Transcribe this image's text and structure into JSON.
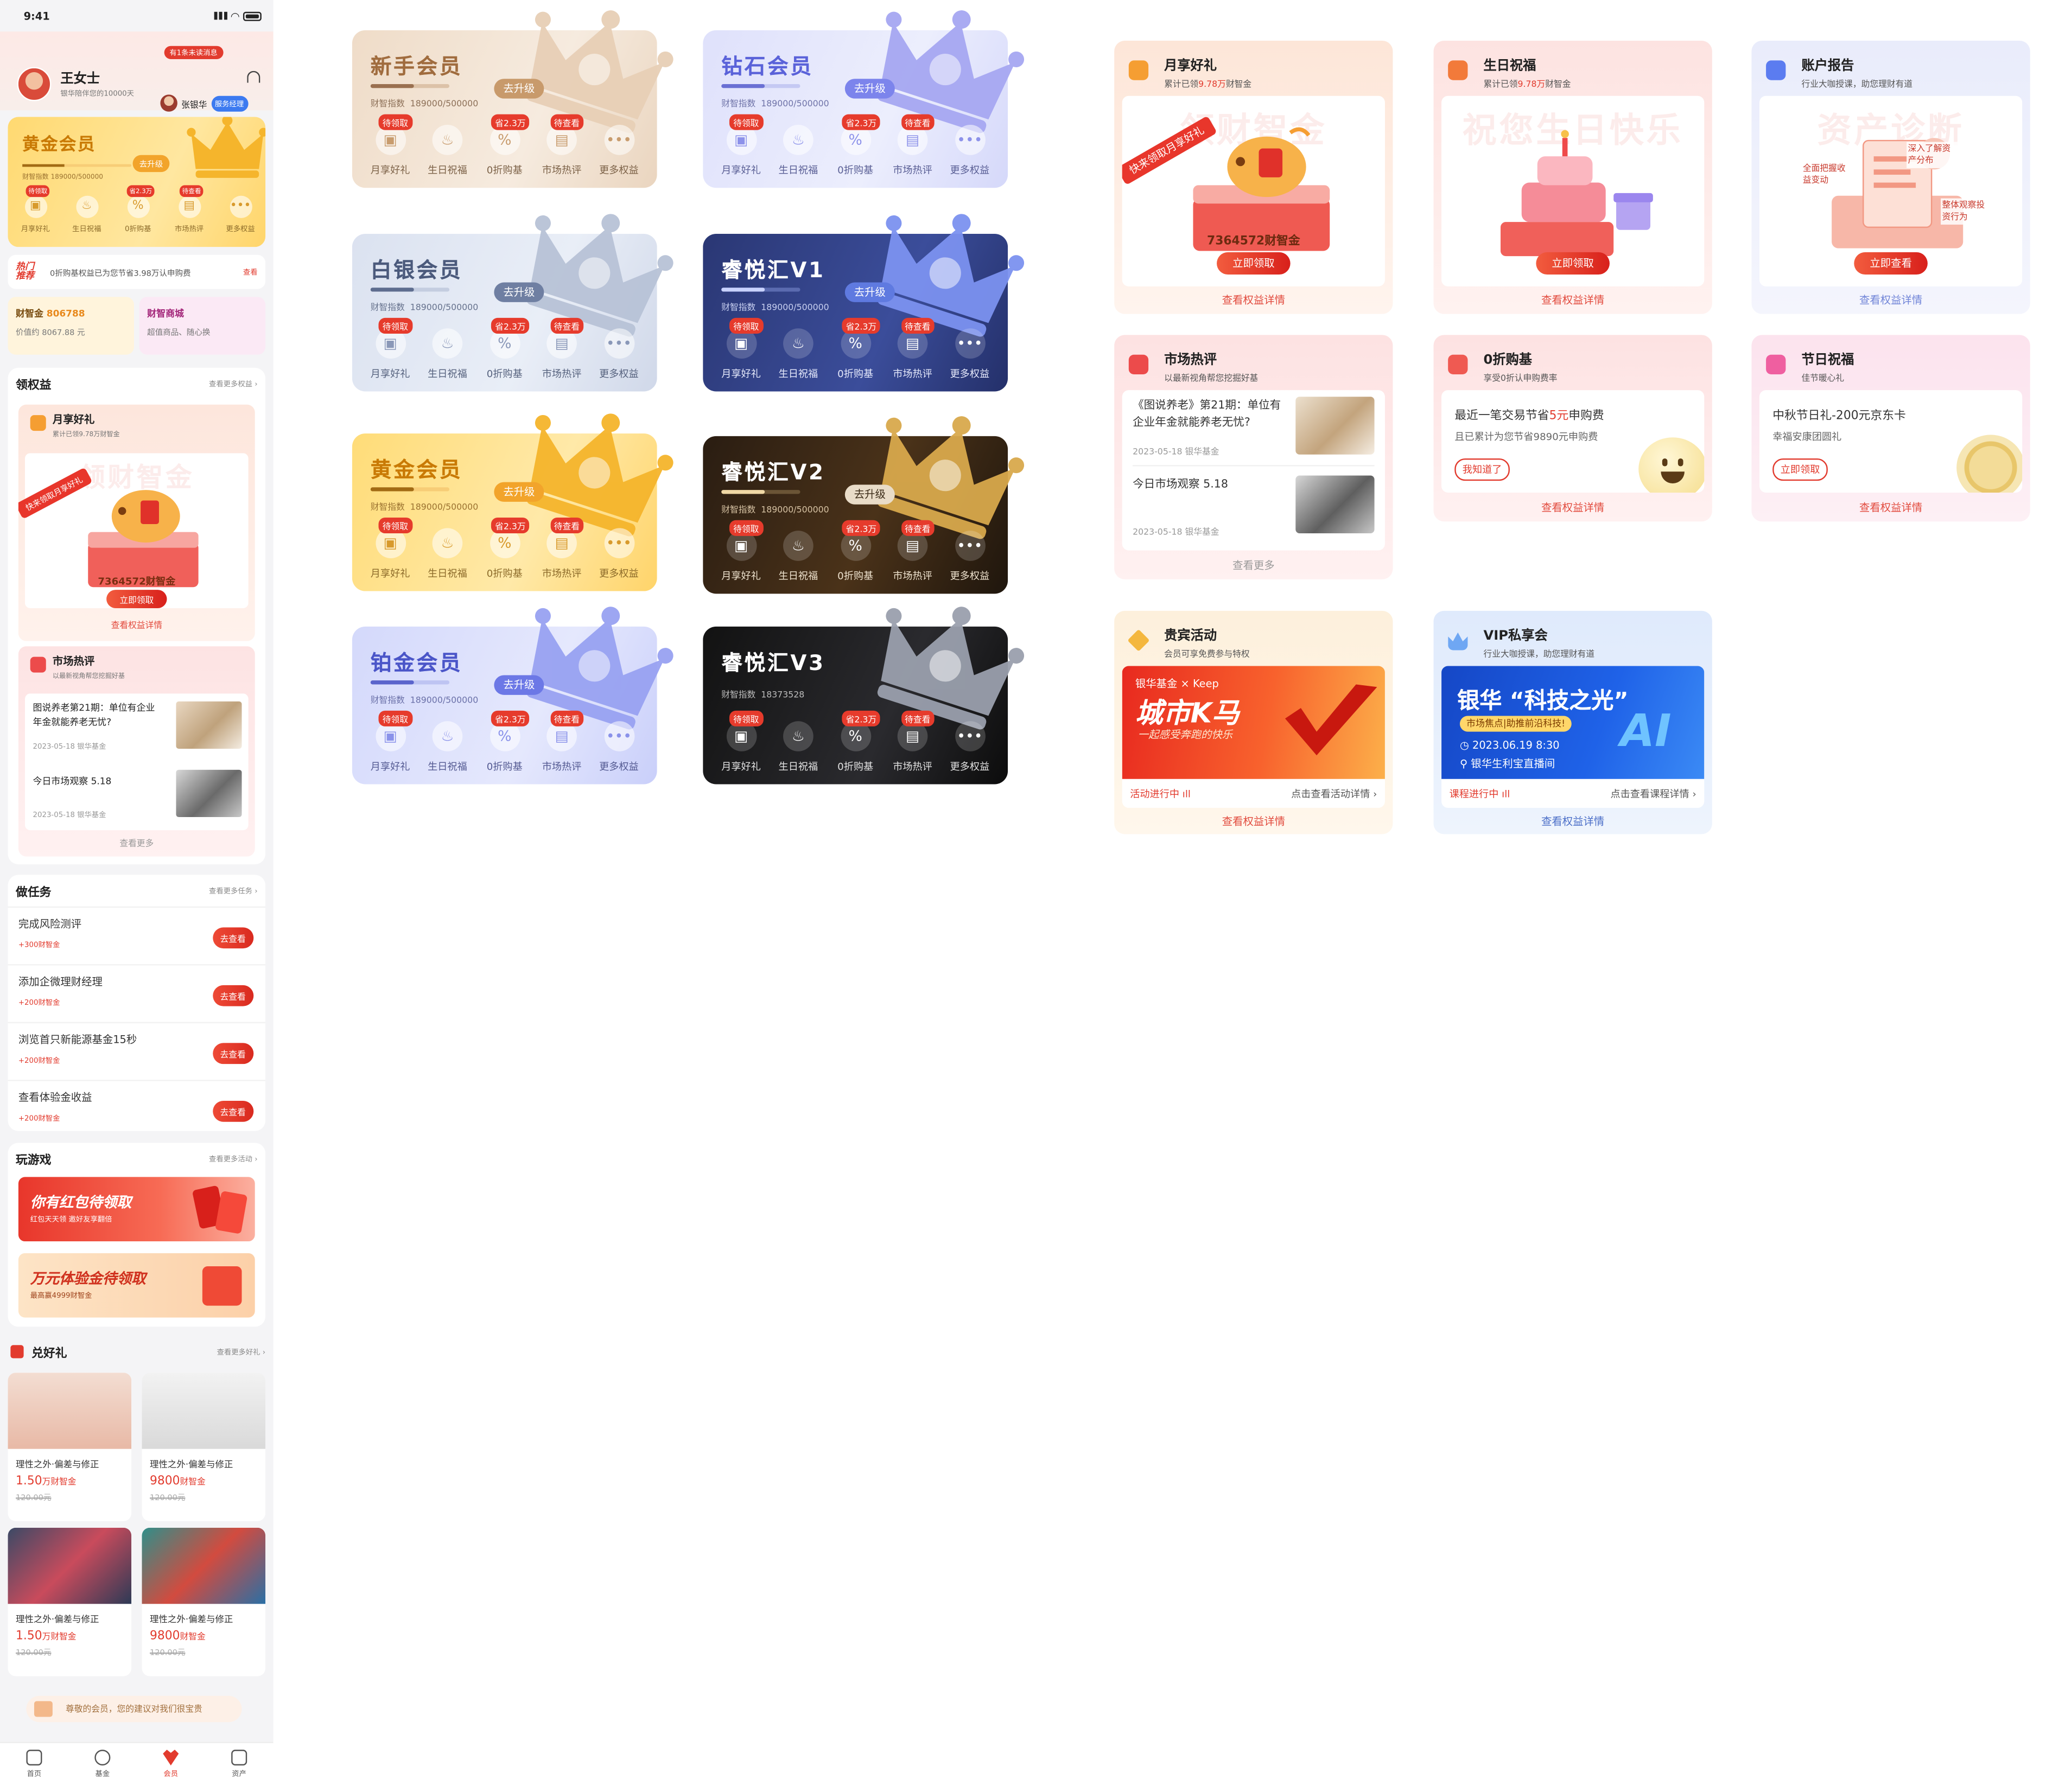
{
  "phone": {
    "status_time": "9:41",
    "profile": {
      "name": "王女士",
      "subtitle": "银华陪伴您的10000天",
      "message_tip": "有1条未读消息",
      "manager_name": "张银华",
      "manager_badge": "服务经理"
    },
    "gold_card": {
      "title": "黄金会员",
      "upgrade": "去升级",
      "index_label": "财智指数",
      "index_value": "189000/500000",
      "progress": 0.38,
      "icons": [
        {
          "label": "月享好礼",
          "badge": "待领取",
          "icon": "gift-icon"
        },
        {
          "label": "生日祝福",
          "badge": "",
          "icon": "cake-icon"
        },
        {
          "label": "0折购基",
          "badge": "省2.3万",
          "icon": "discount-icon"
        },
        {
          "label": "市场热评",
          "badge": "待查看",
          "icon": "book-icon"
        },
        {
          "label": "更多权益",
          "badge": "",
          "icon": "more-icon"
        }
      ]
    },
    "hot": {
      "logo_line1": "热门",
      "logo_line2": "推荐",
      "text": "0折购基权益已为您节省3.98万认申购费",
      "link": "查看"
    },
    "assets": [
      {
        "title": "财智金",
        "value": "806788",
        "sub": "价值约 8067.88 元"
      },
      {
        "title": "财智商城",
        "value": "",
        "sub": "超值商品、随心换"
      }
    ],
    "benefits": {
      "title": "领权益",
      "more": "查看更多权益",
      "monthly": {
        "title": "月享好礼",
        "sub": "累计已领9.78万财智金",
        "watermark": "领财智金",
        "ribbon": "快来领取月享好礼",
        "amount": "7364572财智金",
        "button": "立即领取",
        "footer": "查看权益详情"
      },
      "market": {
        "title": "市场热评",
        "sub": "以最新视角帮您挖掘好基",
        "items": [
          {
            "title": "图说养老第21期：单位有企业年金就能养老无忧?",
            "date": "2023-05-18 银华基金"
          },
          {
            "title": "今日市场观察 5.18",
            "date": "2023-05-18 银华基金"
          }
        ],
        "footer": "查看更多"
      }
    },
    "tasks": {
      "title": "做任务",
      "more": "查看更多任务",
      "items": [
        {
          "name": "完成风险测评",
          "points": "+300财智金",
          "button": "去查看"
        },
        {
          "name": "添加企微理财经理",
          "points": "+200财智金",
          "button": "去查看"
        },
        {
          "name": "浏览首只新能源基金15秒",
          "points": "+200财智金",
          "button": "去查看"
        },
        {
          "name": "查看体验金收益",
          "points": "+200财智金",
          "button": "去查看"
        }
      ]
    },
    "games": {
      "title": "玩游戏",
      "more": "查看更多活动",
      "banners": [
        {
          "title": "你有红包待领取",
          "sub": "红包天天领 邀好友享翻倍"
        },
        {
          "title": "万元体验金待领取",
          "sub": "最高赢4999财智金"
        }
      ]
    },
    "gifts": {
      "title": "兑好礼",
      "more": "查看更多好礼",
      "items": [
        {
          "name": "理性之外·偏差与修正",
          "price": "1.50",
          "unit": "万财智金",
          "orig": "120.00元"
        },
        {
          "name": "理性之外·偏差与修正",
          "price": "9800",
          "unit": "财智金",
          "orig": "120.00元"
        },
        {
          "name": "理性之外·偏差与修正",
          "price": "1.50",
          "unit": "万财智金",
          "orig": "120.00元"
        },
        {
          "name": "理性之外·偏差与修正",
          "price": "9800",
          "unit": "财智金",
          "orig": "120.00元"
        }
      ]
    },
    "suggest": "尊敬的会员，您的建议对我们很宝贵",
    "tabs": [
      "首页",
      "基金",
      "会员",
      "资产"
    ]
  },
  "member_cards": [
    {
      "title": "新手会员",
      "upgrade": "去升级",
      "index_label": "财智指数",
      "index_value": "189000/500000",
      "progress": 0.55,
      "theme": "beige"
    },
    {
      "title": "钻石会员",
      "upgrade": "去升级",
      "index_label": "财智指数",
      "index_value": "189000/500000",
      "progress": 0.55,
      "theme": "violet"
    },
    {
      "title": "白银会员",
      "upgrade": "去升级",
      "index_label": "财智指数",
      "index_value": "189000/500000",
      "progress": 0.55,
      "theme": "silver"
    },
    {
      "title": "睿悦汇V1",
      "upgrade": "去升级",
      "index_label": "财智指数",
      "index_value": "189000/500000",
      "progress": 0.55,
      "theme": "navy"
    },
    {
      "title": "黄金会员",
      "upgrade": "去升级",
      "index_label": "财智指数",
      "index_value": "189000/500000",
      "progress": 0.55,
      "theme": "gold"
    },
    {
      "title": "睿悦汇V2",
      "upgrade": "去升级",
      "index_label": "财智指数",
      "index_value": "189000/500000",
      "progress": 0.55,
      "theme": "bronze"
    },
    {
      "title": "铂金会员",
      "upgrade": "去升级",
      "index_label": "财智指数",
      "index_value": "189000/500000",
      "progress": 0.55,
      "theme": "platinum"
    },
    {
      "title": "睿悦汇V3",
      "upgrade": "",
      "index_label": "财智指数",
      "index_value": "18373528",
      "progress": 0,
      "theme": "black"
    }
  ],
  "member_icons": [
    {
      "label": "月享好礼",
      "badge": "待领取",
      "icon": "gift-icon"
    },
    {
      "label": "生日祝福",
      "badge": "",
      "icon": "cake-icon"
    },
    {
      "label": "0折购基",
      "badge": "省2.3万",
      "icon": "discount-icon"
    },
    {
      "label": "市场热评",
      "badge": "待查看",
      "icon": "book-icon"
    },
    {
      "label": "更多权益",
      "badge": "",
      "icon": "more-icon"
    }
  ],
  "benefit_cards": {
    "monthly": {
      "title": "月享好礼",
      "sub_pre": "累计已领",
      "sub_hl": "9.78万",
      "sub_post": "财智金",
      "watermark": "领财智金",
      "ribbon": "快来领取月享好礼",
      "amount": "7364572财智金",
      "button": "立即领取",
      "footer": "查看权益详情"
    },
    "birthday": {
      "title": "生日祝福",
      "sub_pre": "累计已领",
      "sub_hl": "9.78万",
      "sub_post": "财智金",
      "watermark": "祝您生日快乐",
      "button": "立即领取",
      "footer": "查看权益详情"
    },
    "report": {
      "title": "账户报告",
      "sub": "行业大咖授课，助您理财有道",
      "watermark": "资产诊断",
      "tags": [
        "全面把握收益变动",
        "深入了解资产分布",
        "整体观察投资行为"
      ],
      "button": "立即查看",
      "footer": "查看权益详情"
    },
    "market": {
      "title": "市场热评",
      "sub": "以最新视角帮您挖掘好基",
      "items": [
        {
          "title": "《图说养老》第21期：单位有企业年金就能养老无忧?",
          "date": "2023-05-18 银华基金"
        },
        {
          "title": "今日市场观察 5.18",
          "date": "2023-05-18 银华基金"
        }
      ],
      "footer": "查看更多"
    },
    "zero": {
      "title": "0折购基",
      "sub": "享受0折认申购费率",
      "line1_pre": "最近一笔交易节省",
      "line1_hl": "5元",
      "line1_post": "申购费",
      "line2": "且已累计为您节省9890元申购费",
      "button": "我知道了",
      "footer": "查看权益详情"
    },
    "festival": {
      "title": "节日祝福",
      "sub": "佳节暖心礼",
      "line1": "中秋节日礼-200元京东卡",
      "line2": "幸福安康团圆礼",
      "button": "立即领取",
      "footer": "查看权益详情"
    },
    "vip_event": {
      "title": "贵宾活动",
      "sub": "会员可享免费参与特权",
      "banner_top": "银华基金 × Keep",
      "banner_main": "城市K马",
      "banner_sub": "一起感受奔跑的快乐",
      "status": "活动进行中",
      "link": "点击查看活动详情",
      "footer": "查看权益详情"
    },
    "vip_salon": {
      "title": "VIP私享会",
      "sub": "行业大咖授课，助您理财有道",
      "banner_main": "银华 “科技之光”",
      "banner_tag": "市场焦点|助推前沿科技!",
      "banner_time": "2023.06.19 8:30",
      "banner_place": "银华生利宝直播间",
      "status": "课程进行中",
      "link": "点击查看课程详情",
      "footer": "查看权益详情"
    }
  },
  "colors": {
    "accent_red": "#e23b2e",
    "gold": "#f2a42b"
  }
}
